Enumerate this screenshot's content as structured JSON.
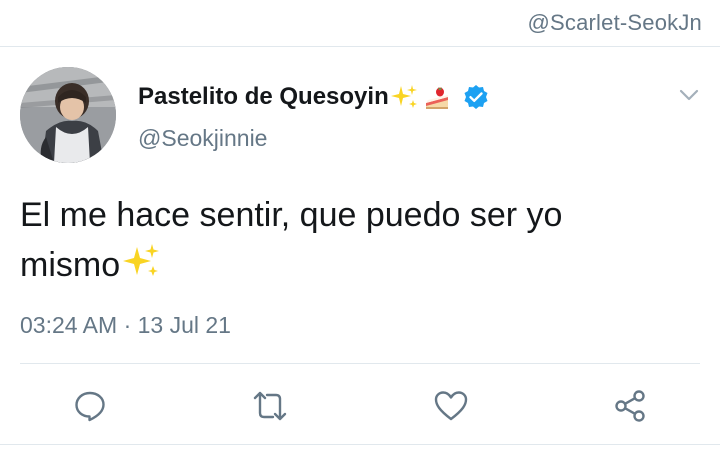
{
  "watermark": {
    "text": "@Scarlet-SeokJn"
  },
  "tweet": {
    "display_name": "Pastelito de Quesoyin",
    "name_emojis": [
      "sparkles-icon",
      "shortcake-icon"
    ],
    "verified": true,
    "handle": "@Seokjinnie",
    "text_line1": "El me hace sentir, que puedo ser yo",
    "text_line2": "mismo",
    "text_trailing_emoji": "sparkles-icon",
    "timestamp": "03:24 AM · 13 Jul 21"
  },
  "actions": [
    {
      "name": "reply",
      "icon": "reply-bubble-icon"
    },
    {
      "name": "retweet",
      "icon": "retweet-icon"
    },
    {
      "name": "like",
      "icon": "heart-icon"
    },
    {
      "name": "share",
      "icon": "share-icon"
    }
  ],
  "colors": {
    "text_primary": "#14171a",
    "text_secondary": "#657786",
    "verified_blue": "#1da1f2",
    "divider": "#e1e8ed",
    "sparkle_yellow": "#f9d423"
  }
}
